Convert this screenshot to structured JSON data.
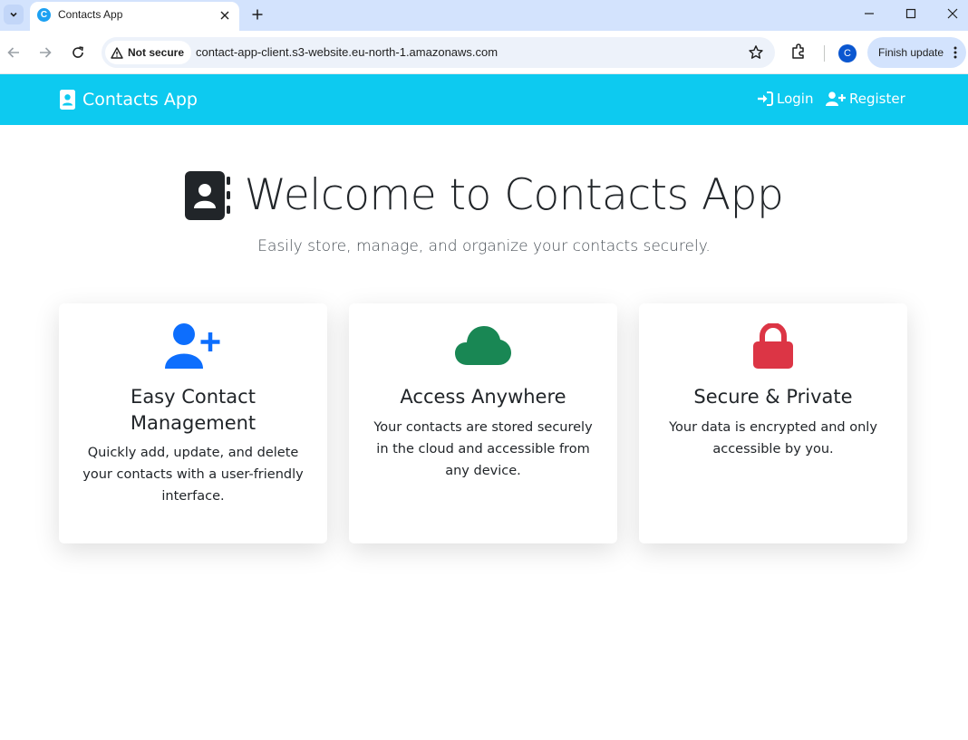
{
  "browser": {
    "tab_title": "Contacts App",
    "tab_favicon_letter": "C",
    "security_label": "Not secure",
    "url": "contact-app-client.s3-website.eu-north-1.amazonaws.com",
    "profile_initial": "C",
    "update_label": "Finish update"
  },
  "navbar": {
    "brand": "Contacts App",
    "login": "Login",
    "register": "Register",
    "color": "#0dcaf0"
  },
  "hero": {
    "title": "Welcome to Contacts App",
    "subtitle": "Easily store, manage, and organize your contacts securely."
  },
  "features": [
    {
      "icon": "user-plus-icon",
      "icon_color": "#0d6efd",
      "title": "Easy Contact Management",
      "text": "Quickly add, update, and delete your contacts with a user-friendly interface."
    },
    {
      "icon": "cloud-icon",
      "icon_color": "#198754",
      "title": "Access Anywhere",
      "text": "Your contacts are stored securely in the cloud and accessible from any device."
    },
    {
      "icon": "lock-icon",
      "icon_color": "#dc3545",
      "title": "Secure & Private",
      "text": "Your data is encrypted and only accessible by you."
    }
  ]
}
